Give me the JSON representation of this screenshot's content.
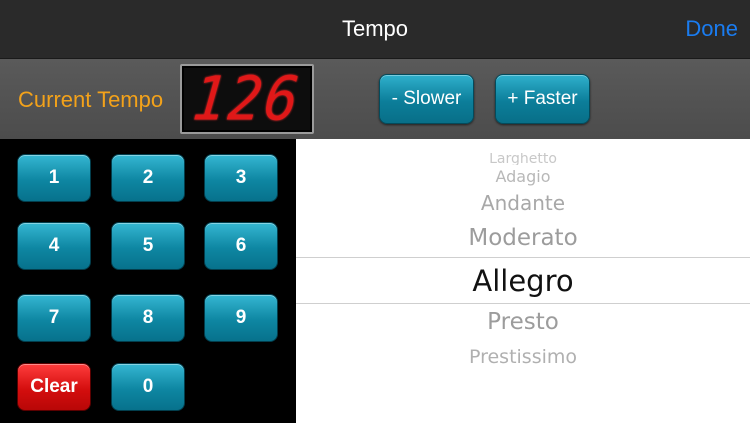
{
  "navbar": {
    "title": "Tempo",
    "done_label": "Done"
  },
  "tempo": {
    "label": "Current Tempo",
    "value": "126",
    "slower_label": "- Slower",
    "faster_label": "+ Faster"
  },
  "keypad": {
    "keys": [
      "1",
      "2",
      "3",
      "4",
      "5",
      "6",
      "7",
      "8",
      "9"
    ],
    "clear_label": "Clear",
    "zero_label": "0"
  },
  "picker": {
    "items": [
      "Larghetto",
      "Adagio",
      "Andante",
      "Moderato",
      "Allegro",
      "Presto",
      "Prestissimo"
    ],
    "selected": "Allegro"
  },
  "colors": {
    "accent_blue": "#1a7cf0",
    "label_orange": "#f3a21a",
    "lcd_red": "#e01818",
    "key_teal": "#0e86a2",
    "clear_red": "#d40e0e"
  }
}
